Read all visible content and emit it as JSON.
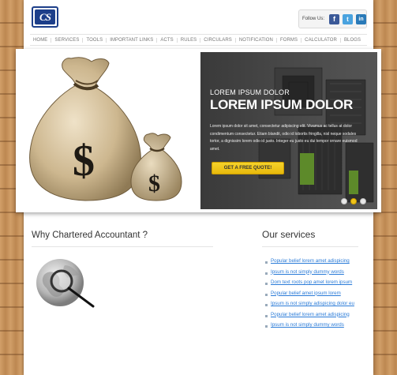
{
  "header": {
    "logo_text": "CS",
    "follow_label": "Follow Us:",
    "social": [
      {
        "icon": "facebook-icon",
        "glyph": "f"
      },
      {
        "icon": "twitter-icon",
        "glyph": "t"
      },
      {
        "icon": "linkedin-icon",
        "glyph": "in"
      }
    ]
  },
  "nav": [
    "HOME",
    "SERVICES",
    "TOOLS",
    "IMPORTANT LINKS",
    "ACTS",
    "RULES",
    "CIRCULARS",
    "NOTIFICATION",
    "FORMS",
    "CALCULATOR",
    "BLOGS"
  ],
  "slider": {
    "kicker": "LOREM IPSUM DOLOR",
    "title": "LOREM IPSUM DOLOR",
    "body": "Lorem ipsum dolor sit amet, consectetur adipiscing elit. Vivamus ac tellus at dolor condimentum consectetur. Etiam blandit, odio id lobortis fringilla, nisl neque sodales tortor, a dignissim lorem odio id justo. Integer eu justo eu dui tempor ornare euismod amet.",
    "cta_label": "GET A FREE QUOTE!",
    "bag_symbol": "$",
    "dots": [
      false,
      true,
      false
    ]
  },
  "why": {
    "heading": "Why Chartered Accountant ?"
  },
  "services": {
    "heading": "Our services",
    "items": [
      "Popular belief lorem amet adispicing",
      "Ipsum is not simply dummy words",
      "Dom text roots pop amet lorem ipsum",
      "Popular belief amet ipsum lorem",
      "Ipsum is not simply adispicing dolor eu",
      "Popular belief lorem amet adispicing",
      "Ipsum is not simply dummy words"
    ]
  },
  "colors": {
    "accent_yellow": "#f0c419",
    "link_blue": "#2a7bd8",
    "logo_blue": "#1d3f8a",
    "slide_dark": "#3a3a3a"
  }
}
